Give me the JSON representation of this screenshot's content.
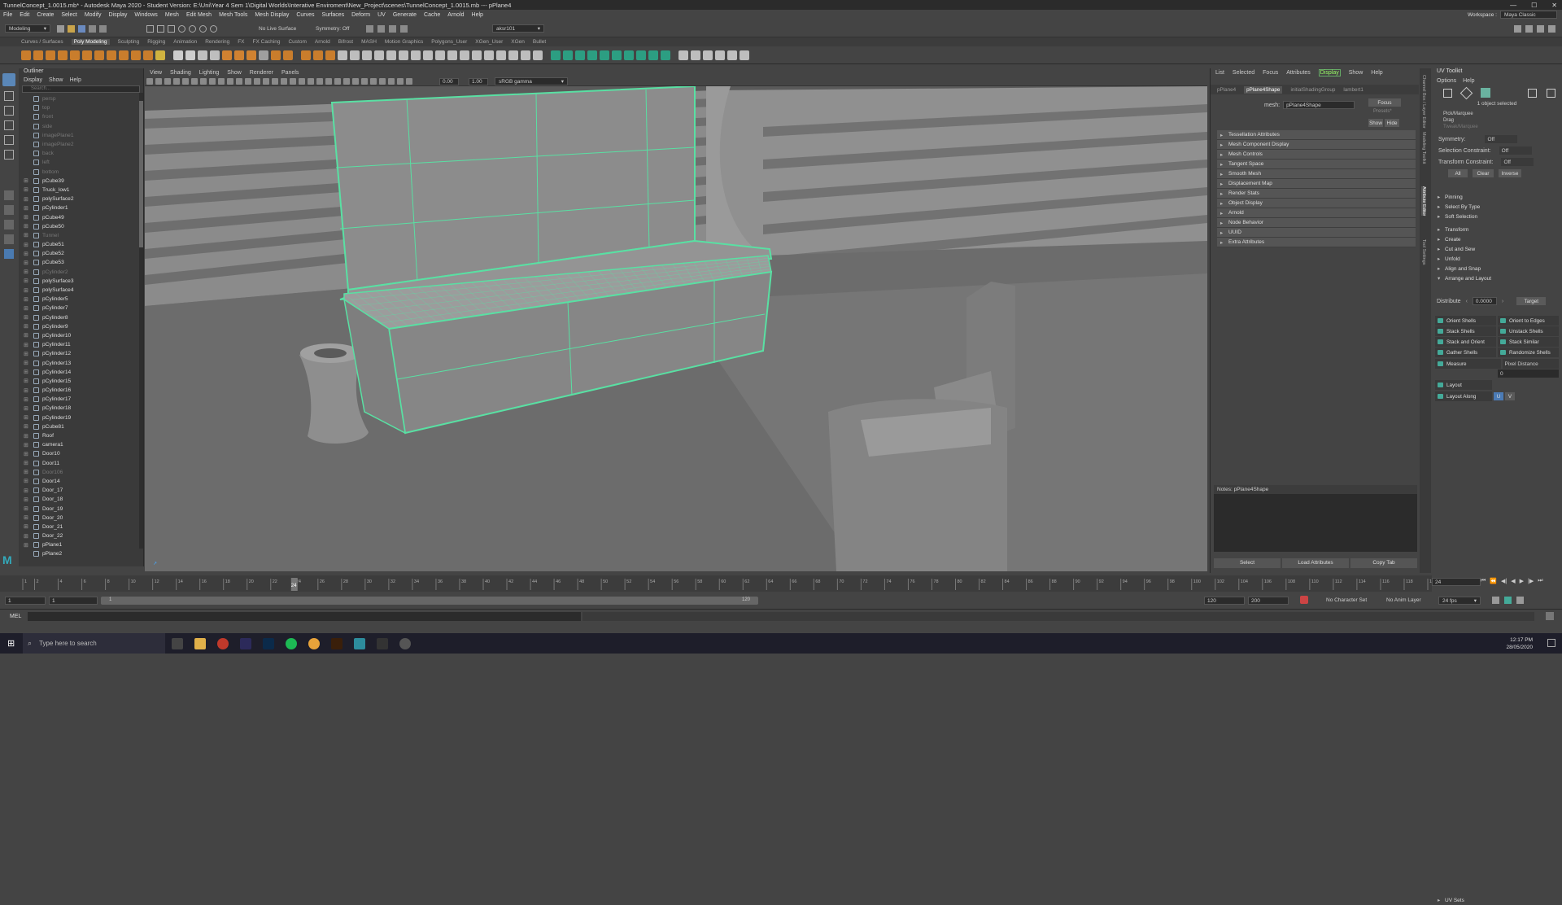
{
  "title": "TunnelConcept_1.0015.mb* - Autodesk Maya 2020 - Student Version: E:\\Uni\\Year 4 Sem 1\\Digital Worlds\\Interative Enviroment\\New_Project\\scenes\\TunnelConcept_1.0015.mb  ---  pPlane4",
  "menus": [
    "File",
    "Edit",
    "Create",
    "Select",
    "Modify",
    "Display",
    "Windows",
    "Mesh",
    "Edit Mesh",
    "Mesh Tools",
    "Mesh Display",
    "Curves",
    "Surfaces",
    "Deform",
    "UV",
    "Generate",
    "Cache",
    "Arnold",
    "Help"
  ],
  "workspace": {
    "label": "Workspace :",
    "value": "Maya Classic"
  },
  "statusline": {
    "mode": "Modeling",
    "live": "No Live Surface",
    "symmetry": "Symmetry: Off",
    "user": "aksr101"
  },
  "shelf_tabs": [
    "Curves / Surfaces",
    "Poly Modeling",
    "Sculpting",
    "Rigging",
    "Animation",
    "Rendering",
    "FX",
    "FX Caching",
    "Custom",
    "Arnold",
    "Bifrost",
    "MASH",
    "Motion Graphics",
    "Polygons_User",
    "XGen_User",
    "XGen",
    "Bullet"
  ],
  "outliner": {
    "title": "Outliner",
    "menu": [
      "Display",
      "Show",
      "Help"
    ],
    "search_placeholder": "Search...",
    "items": [
      {
        "name": "persp",
        "dim": true
      },
      {
        "name": "top",
        "dim": true
      },
      {
        "name": "front",
        "dim": true
      },
      {
        "name": "side",
        "dim": true
      },
      {
        "name": "imagePlane1",
        "dim": true
      },
      {
        "name": "imagePlane2",
        "dim": true
      },
      {
        "name": "back",
        "dim": true
      },
      {
        "name": "left",
        "dim": true
      },
      {
        "name": "bottom",
        "dim": true
      },
      {
        "name": "pCube39",
        "dim": false
      },
      {
        "name": "Truck_low1",
        "dim": false
      },
      {
        "name": "polySurface2",
        "dim": false
      },
      {
        "name": "pCylinder1",
        "dim": false
      },
      {
        "name": "pCube49",
        "dim": false
      },
      {
        "name": "pCube50",
        "dim": false
      },
      {
        "name": "Tunnel",
        "dim": true
      },
      {
        "name": "pCube51",
        "dim": false
      },
      {
        "name": "pCube52",
        "dim": false
      },
      {
        "name": "pCube53",
        "dim": false
      },
      {
        "name": "pCylinder2",
        "dim": true
      },
      {
        "name": "polySurface3",
        "dim": false
      },
      {
        "name": "polySurface4",
        "dim": false
      },
      {
        "name": "pCylinder5",
        "dim": false
      },
      {
        "name": "pCylinder7",
        "dim": false
      },
      {
        "name": "pCylinder8",
        "dim": false
      },
      {
        "name": "pCylinder9",
        "dim": false
      },
      {
        "name": "pCylinder10",
        "dim": false
      },
      {
        "name": "pCylinder11",
        "dim": false
      },
      {
        "name": "pCylinder12",
        "dim": false
      },
      {
        "name": "pCylinder13",
        "dim": false
      },
      {
        "name": "pCylinder14",
        "dim": false
      },
      {
        "name": "pCylinder15",
        "dim": false
      },
      {
        "name": "pCylinder16",
        "dim": false
      },
      {
        "name": "pCylinder17",
        "dim": false
      },
      {
        "name": "pCylinder18",
        "dim": false
      },
      {
        "name": "pCylinder19",
        "dim": false
      },
      {
        "name": "pCube81",
        "dim": false
      },
      {
        "name": "Roof",
        "dim": false
      },
      {
        "name": "camera1",
        "dim": false
      },
      {
        "name": "Door10",
        "dim": false
      },
      {
        "name": "Door11",
        "dim": false
      },
      {
        "name": "Door106",
        "dim": true
      },
      {
        "name": "Door14",
        "dim": false
      },
      {
        "name": "Door_17",
        "dim": false
      },
      {
        "name": "Door_18",
        "dim": false
      },
      {
        "name": "Door_19",
        "dim": false
      },
      {
        "name": "Door_20",
        "dim": false
      },
      {
        "name": "Door_21",
        "dim": false
      },
      {
        "name": "Door_22",
        "dim": false
      },
      {
        "name": "pPlane1",
        "dim": false
      },
      {
        "name": "pPlane2",
        "dim": false
      }
    ]
  },
  "viewport": {
    "menus": [
      "View",
      "Shading",
      "Lighting",
      "Show",
      "Renderer",
      "Panels"
    ],
    "exposure": "0.00",
    "gamma": "1.00",
    "colorspace": "sRGB gamma"
  },
  "attribute_editor": {
    "tabs": [
      "List",
      "Selected",
      "Focus",
      "Attributes",
      "Display",
      "Show",
      "Help"
    ],
    "active_tab": "Display",
    "nodes": [
      "pPlane4",
      "pPlane4Shape",
      "initialShadingGroup",
      "lambert1"
    ],
    "active_node": "pPlane4Shape",
    "mesh_label": "mesh:",
    "mesh_value": "pPlane4Shape",
    "focus": "Focus",
    "presets": "Presets*",
    "show": "Show",
    "hide": "Hide",
    "sections": [
      "Tessellation Attributes",
      "Mesh Component Display",
      "Mesh Controls",
      "Tangent Space",
      "Smooth Mesh",
      "Displacement Map",
      "Render Stats",
      "Object Display",
      "Arnold",
      "Node Behavior",
      "UUID",
      "Extra Attributes"
    ],
    "notes": "Notes: pPlane4Shape",
    "buttons": [
      "Select",
      "Load Attributes",
      "Copy Tab"
    ]
  },
  "side_tabs": [
    "Channel Box / Layer Editor",
    "Modeling Toolkit",
    "Attribute Editor",
    "Tool Settings"
  ],
  "uv_toolkit": {
    "title": "UV Toolkit",
    "menu": [
      "Options",
      "Help"
    ],
    "selected": "1 object selected",
    "modes": [
      "Pick/Marquee",
      "Drag",
      "Tweak/Marquee"
    ],
    "symmetry": {
      "label": "Symmetry:",
      "value": "Off"
    },
    "sel_constraint": {
      "label": "Selection Constraint:",
      "value": "Off"
    },
    "xf_constraint": {
      "label": "Transform Constraint:",
      "value": "Off"
    },
    "sel_buttons": [
      "All",
      "Clear",
      "Inverse"
    ],
    "sections_top": [
      "Pinning",
      "Select By Type",
      "Soft Selection"
    ],
    "sections": [
      "Transform",
      "Create",
      "Cut and Sew",
      "Unfold",
      "Align and Snap"
    ],
    "arrange": "Arrange and Layout",
    "distribute": {
      "label": "Distribute",
      "value": "0.0000",
      "target": "Target"
    },
    "shell_buttons": [
      "Orient Shells",
      "Orient to Edges",
      "Stack Shells",
      "Unstack Shells",
      "Stack and Orient",
      "Stack Similar",
      "Gather Shells",
      "Randomize Shells"
    ],
    "measure": {
      "label": "Measure",
      "value": "Pixel Distance",
      "num": "0"
    },
    "layout": "Layout",
    "layout_along": {
      "label": "Layout Along",
      "u": "U",
      "v": "V"
    },
    "uvsets": "UV Sets"
  },
  "timeline": {
    "ticks": [
      "1",
      "2",
      "4",
      "6",
      "8",
      "10",
      "12",
      "14",
      "16",
      "18",
      "20",
      "22",
      "24",
      "26",
      "28",
      "30",
      "32",
      "34",
      "36",
      "38",
      "40",
      "42",
      "44",
      "46",
      "48",
      "50",
      "52",
      "54",
      "56",
      "58",
      "60",
      "62",
      "64",
      "66",
      "68",
      "70",
      "72",
      "74",
      "76",
      "78",
      "80",
      "82",
      "84",
      "86",
      "88",
      "90",
      "92",
      "94",
      "96",
      "98",
      "100",
      "102",
      "104",
      "106",
      "108",
      "110",
      "112",
      "114",
      "116",
      "118",
      "120"
    ],
    "current": "24",
    "current_field": "24",
    "range_start": "1",
    "range_start2": "1",
    "range_inner_start": "1",
    "range_inner_end": "120",
    "end": "120",
    "end2": "200",
    "char_set": "No Character Set",
    "anim_layer": "No Anim Layer",
    "fps": "24 fps"
  },
  "mel_label": "MEL",
  "taskbar": {
    "search": "Type here to search",
    "time": "12:17 PM",
    "date": "28/05/2020"
  }
}
